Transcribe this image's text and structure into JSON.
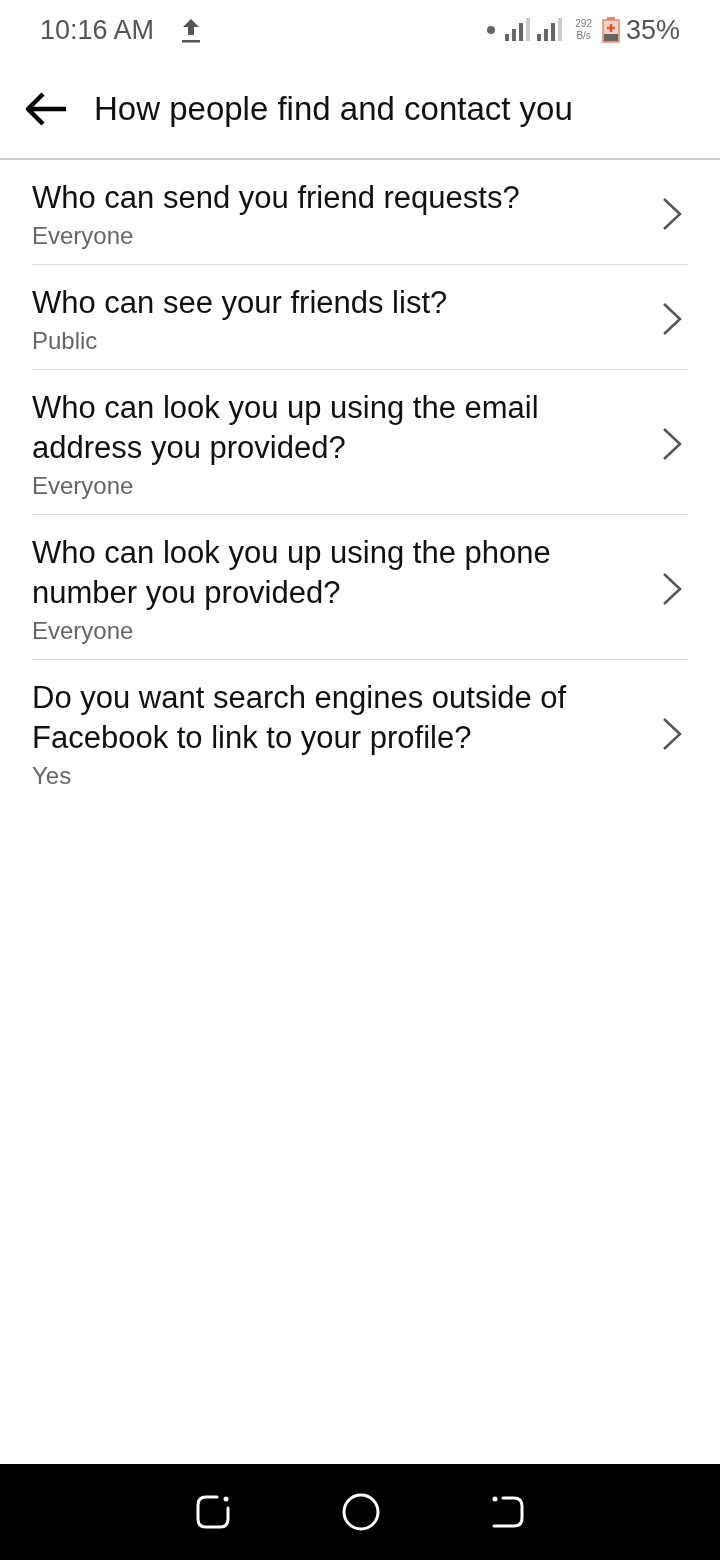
{
  "status_bar": {
    "time": "10:16 AM",
    "speed_value": "292",
    "speed_unit": "B/s",
    "battery": "35%"
  },
  "header": {
    "title": "How people find and contact you"
  },
  "settings": [
    {
      "question": "Who can send you friend requests?",
      "value": "Everyone"
    },
    {
      "question": "Who can see your friends list?",
      "value": "Public"
    },
    {
      "question": "Who can look you up using the email address you provided?",
      "value": "Everyone"
    },
    {
      "question": "Who can look you up using the phone number you provided?",
      "value": "Everyone"
    },
    {
      "question": "Do you want search engines outside of Facebook to link to your profile?",
      "value": "Yes"
    }
  ]
}
